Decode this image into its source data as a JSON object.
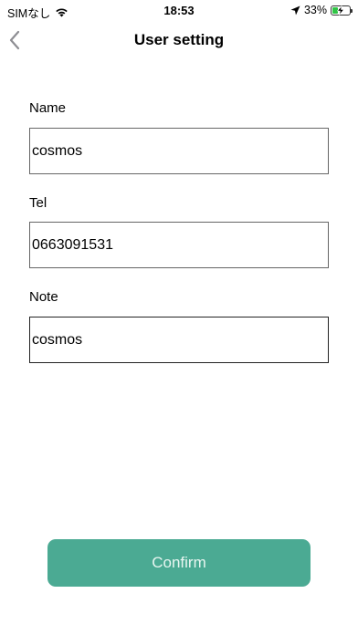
{
  "status_bar": {
    "carrier": "SIMなし",
    "time": "18:53",
    "battery_percent": "33%",
    "battery_level": 0.33,
    "icons": [
      "wifi-icon",
      "location-arrow-icon",
      "battery-charging-icon"
    ]
  },
  "nav": {
    "back_icon": "chevron-left-icon",
    "title": "User setting"
  },
  "form": {
    "name": {
      "label": "Name",
      "value": "cosmos"
    },
    "tel": {
      "label": "Tel",
      "value": "0663091531"
    },
    "note": {
      "label": "Note",
      "value": "cosmos"
    }
  },
  "actions": {
    "confirm_label": "Confirm"
  },
  "colors": {
    "accent": "#4baa93",
    "button_text": "#e8f6f1",
    "battery_charging": "#2fc545",
    "border": "#666666"
  }
}
